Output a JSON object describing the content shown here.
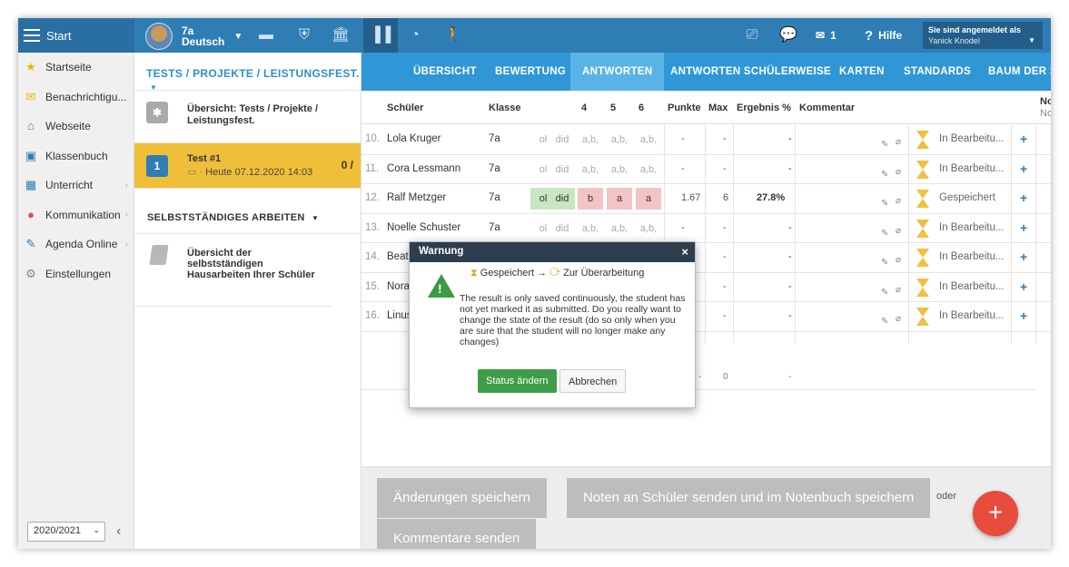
{
  "topbar": {
    "start_label": "Start",
    "class_name": "7a",
    "subject": "Deutsch",
    "mail_count": "1",
    "help_label": "Hilfe",
    "logged_in_label": "Sie sind angemeldet als",
    "user_name": "Yanick Knodel"
  },
  "sidebar": {
    "items": [
      {
        "label": "Startseite",
        "icon": "star-icon",
        "color": "#f0b400"
      },
      {
        "label": "Benachrichtigu...",
        "icon": "envelope-icon",
        "color": "#f0b400"
      },
      {
        "label": "Webseite",
        "icon": "home-icon",
        "color": "#3a9a50"
      },
      {
        "label": "Klassenbuch",
        "icon": "book-icon",
        "color": "#2f7db5"
      },
      {
        "label": "Unterricht",
        "icon": "classroom-icon",
        "color": "#2f7db5"
      },
      {
        "label": "Kommunikation",
        "icon": "chat-icon",
        "color": "#d9534f"
      },
      {
        "label": "Agenda Online",
        "icon": "pen-icon",
        "color": "#2f7db5"
      },
      {
        "label": "Einstellungen",
        "icon": "gear-icon",
        "color": "#888888"
      }
    ],
    "year": "2020/2021"
  },
  "panel2": {
    "heading": "TESTS / PROJEKTE / LEISTUNGSFEST.",
    "overview_label": "Übersicht: Tests / Projekte / Leistungsfest.",
    "test_name": "Test #1",
    "test_badge": "1",
    "test_date": "Heute 07.12.2020 14:03",
    "test_count": "0 /",
    "section_heading": "SELBSTSTÄNDIGES ARBEITEN",
    "homework_label": "Übersicht der selbstständigen Hausarbeiten Ihrer Schüler"
  },
  "tabs": [
    "ÜBERSICHT",
    "BEWERTUNG",
    "ANTWORTEN",
    "ANTWORTEN SCHÜLERWEISE",
    "KARTEN",
    "STANDARDS",
    "BAUM DER ST"
  ],
  "active_tab": "ANTWORTEN",
  "table": {
    "headers": {
      "student": "Schüler",
      "class": "Klasse",
      "q4": "4",
      "q5": "5",
      "q6": "6",
      "points": "Punkte",
      "max": "Max",
      "result": "Ergebnis %",
      "comment": "Kommentar",
      "extra": "No",
      "extra2": "No"
    },
    "rows": [
      {
        "num": "10.",
        "name": "Lola Kruger",
        "klasse": "7a",
        "cells": [
          "ol",
          "did",
          "a,b,",
          "a,b,",
          "a,b,"
        ],
        "cellstyle": [
          "",
          "",
          "",
          "",
          ""
        ],
        "points": "-",
        "max": "-",
        "result": "-",
        "status": "In Bearbeitu..."
      },
      {
        "num": "11.",
        "name": "Cora Lessmann",
        "klasse": "7a",
        "cells": [
          "ol",
          "did",
          "a,b,",
          "a,b,",
          "a,b,"
        ],
        "cellstyle": [
          "",
          "",
          "",
          "",
          ""
        ],
        "points": "-",
        "max": "-",
        "result": "-",
        "status": "In Bearbeitu..."
      },
      {
        "num": "12.",
        "name": "Ralf Metzger",
        "klasse": "7a",
        "cells": [
          "ol",
          "did",
          "b",
          "a",
          "a"
        ],
        "cellstyle": [
          "g",
          "g",
          "r",
          "r",
          "r"
        ],
        "points": "1.67",
        "max": "6",
        "result": "27.8%",
        "status": "Gespeichert"
      },
      {
        "num": "13.",
        "name": "Noelle Schuster",
        "klasse": "7a",
        "cells": [
          "ol",
          "did",
          "a,b,",
          "a,b,",
          "a,b,"
        ],
        "cellstyle": [
          "",
          "",
          "",
          "",
          ""
        ],
        "points": "-",
        "max": "-",
        "result": "-",
        "status": "In Bearbeitu..."
      },
      {
        "num": "14.",
        "name": "Beat",
        "klasse": "",
        "cells": [
          "",
          "",
          "",
          "",
          ""
        ],
        "cellstyle": [
          "",
          "",
          "",
          "",
          ""
        ],
        "points": "-",
        "max": "-",
        "result": "-",
        "status": "In Bearbeitu..."
      },
      {
        "num": "15.",
        "name": "Nora",
        "klasse": "",
        "cells": [
          "",
          "",
          "",
          "",
          ""
        ],
        "cellstyle": [
          "",
          "",
          "",
          "",
          ""
        ],
        "points": "-",
        "max": "-",
        "result": "-",
        "status": "In Bearbeitu..."
      },
      {
        "num": "16.",
        "name": "Linus",
        "klasse": "",
        "cells": [
          "",
          "",
          "",
          "",
          ""
        ],
        "cellstyle": [
          "",
          "",
          "",
          "",
          ""
        ],
        "points": "-",
        "max": "-",
        "result": "-",
        "status": "In Bearbeitu..."
      }
    ],
    "summary": {
      "points": "-",
      "max": "0",
      "result": "-"
    }
  },
  "footer": {
    "save_label": "Änderungen speichern",
    "send_label": "Noten an Schüler senden und im Notenbuch speichern",
    "or_label": "oder",
    "comments_label": "Kommentare senden",
    "fab_label": "+"
  },
  "modal": {
    "title": "Warnung",
    "close": "×",
    "from_state": "Gespeichert",
    "arrow": "→",
    "to_state": "Zur Überarbeitung",
    "message": "The result is only saved continuously, the student has not yet marked it as submitted. Do you really want to change the state of the result (do so only when you are sure that the student will no longer make any changes)",
    "confirm_label": "Status ändern",
    "cancel_label": "Abbrechen"
  }
}
